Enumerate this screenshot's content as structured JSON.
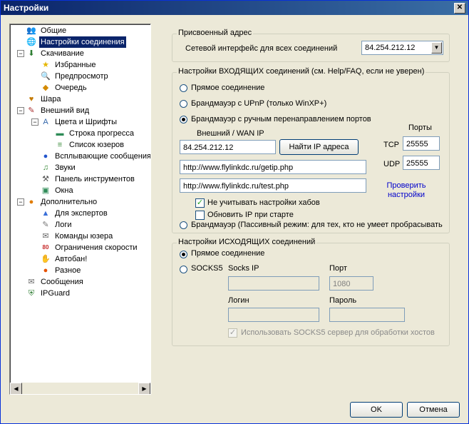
{
  "window": {
    "title": "Настройки",
    "close_label": "✕"
  },
  "tree": {
    "items": [
      {
        "label": "Общие",
        "icon": "users-icon",
        "glyph": "👥"
      },
      {
        "label": "Настройки соединения",
        "icon": "connection-icon",
        "glyph": "🌐",
        "selected": true
      },
      {
        "label": "Скачивание",
        "icon": "download-icon",
        "glyph": "⬇"
      },
      {
        "label": "Избранные",
        "icon": "star-icon",
        "glyph": "★"
      },
      {
        "label": "Предпросмотр",
        "icon": "preview-icon",
        "glyph": "🔍"
      },
      {
        "label": "Очередь",
        "icon": "queue-icon",
        "glyph": "◆"
      },
      {
        "label": "Шара",
        "icon": "share-icon",
        "glyph": "♥"
      },
      {
        "label": "Внешний вид",
        "icon": "appearance-icon",
        "glyph": "✎"
      },
      {
        "label": "Цвета и Шрифты",
        "icon": "fonts-icon",
        "glyph": "A"
      },
      {
        "label": "Строка прогресса",
        "icon": "progress-icon",
        "glyph": "▬"
      },
      {
        "label": "Список юзеров",
        "icon": "userlist-icon",
        "glyph": "≡"
      },
      {
        "label": "Всплывающие сообщения",
        "icon": "popup-icon",
        "glyph": "●"
      },
      {
        "label": "Звуки",
        "icon": "sound-icon",
        "glyph": "♫"
      },
      {
        "label": "Панель инструментов",
        "icon": "toolbar-icon",
        "glyph": "⚒"
      },
      {
        "label": "Окна",
        "icon": "windows-icon",
        "glyph": "▣"
      },
      {
        "label": "Дополнительно",
        "icon": "advanced-icon",
        "glyph": "●"
      },
      {
        "label": "Для экспертов",
        "icon": "expert-icon",
        "glyph": "▲"
      },
      {
        "label": "Логи",
        "icon": "logs-icon",
        "glyph": "✎"
      },
      {
        "label": "Команды юзера",
        "icon": "commands-icon",
        "glyph": "✉"
      },
      {
        "label": "Ограничения скорости",
        "icon": "speed-limit-icon",
        "glyph": "80"
      },
      {
        "label": "Автобан!",
        "icon": "autoban-icon",
        "glyph": "✋"
      },
      {
        "label": "Разное",
        "icon": "misc-icon",
        "glyph": "●"
      },
      {
        "label": "Сообщения",
        "icon": "messages-icon",
        "glyph": "✉"
      },
      {
        "label": "IPGuard",
        "icon": "ipguard-icon",
        "glyph": "⛨"
      }
    ],
    "scroll_left": "◀",
    "scroll_right": "▶"
  },
  "assigned": {
    "title": "Присвоенный адрес",
    "label": "Сетевой интерфейс для всех соединений",
    "value": "84.254.212.12",
    "arrow": "▼"
  },
  "incoming": {
    "title": "Настройки ВХОДЯЩИХ соединений (см. Help/FAQ, если не уверен)",
    "options": [
      {
        "label": "Прямое соединение",
        "selected": false
      },
      {
        "label": "Брандмауэр с UPnP (только WinXP+)",
        "selected": false
      },
      {
        "label": "Брандмауэр с ручным перенаправлением портов",
        "selected": true
      },
      {
        "label": "Брандмауэр (Пассивный режим: для тех, кто не умеет пробрасывать",
        "selected": false
      }
    ],
    "wan_label": "Внешний / WAN IP",
    "wan_ip": "84.254.212.12",
    "find_ip_button": "Найти IP адреса",
    "ports_label": "Порты",
    "tcp_label": "TCP",
    "tcp_value": "25555",
    "udp_label": "UDP",
    "udp_value": "25555",
    "getip_url": "http://www.flylinkdc.ru/getip.php",
    "test_url": "http://www.flylinkdc.ru/test.php",
    "check_link": "Проверить настройки",
    "ignore_hubs": {
      "label": "Не учитывать настройки хабов",
      "checked": true
    },
    "update_ip": {
      "label": "Обновить IP при старте",
      "checked": false
    },
    "check_mark": "✓"
  },
  "outgoing": {
    "title": "Настройки ИСХОДЯЩИХ соединений",
    "direct_label": "Прямое соединение",
    "socks_label": "SOCKS5",
    "socks_ip_label": "Socks IP",
    "port_label": "Порт",
    "port_value": "1080",
    "login_label": "Логин",
    "password_label": "Пароль",
    "use_socks_label": "Использовать SOCKS5 сервер для обработки хостов",
    "check_mark": "✓"
  },
  "buttons": {
    "ok": "OK",
    "cancel": "Отмена"
  }
}
